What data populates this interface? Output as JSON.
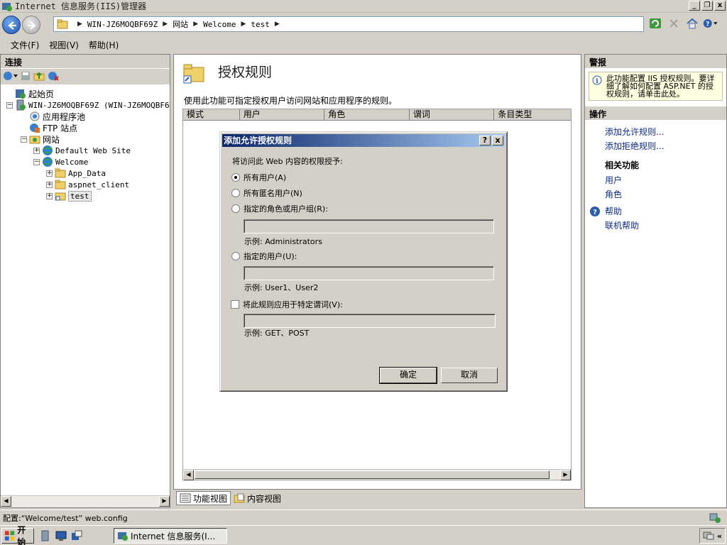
{
  "window": {
    "title": "Internet 信息服务(IIS)管理器",
    "buttons": {
      "minimize": "_",
      "restore": "❐",
      "close": "x"
    }
  },
  "address": {
    "crumbs": [
      "WIN-JZ6MOQBF69Z",
      "网站",
      "Welcome",
      "test"
    ]
  },
  "menu": [
    "文件(F)",
    "视图(V)",
    "帮助(H)"
  ],
  "connections": {
    "title": "连接",
    "tree": {
      "start_page": "起始页",
      "server": "WIN-JZ6MOQBF69Z (WIN-JZ6MOQBF69Z",
      "app_pools": "应用程序池",
      "ftp_sites": "FTP 站点",
      "sites": "网站",
      "default_site": "Default Web Site",
      "welcome": "Welcome",
      "app_data": "App_Data",
      "aspnet_client": "aspnet_client",
      "test": "test"
    }
  },
  "feature": {
    "title": "授权规则",
    "description": "使用此功能可指定授权用户访问网站和应用程序的规则。",
    "columns": [
      "模式",
      "用户",
      "角色",
      "谓词",
      "条目类型"
    ]
  },
  "view_tabs": {
    "features": "功能视图",
    "content": "内容视图"
  },
  "alerts": {
    "title": "警报",
    "message": "此功能配置 IIS 授权规则。要详细了解如何配置 ASP.NET 的授权规则，请单击此处。"
  },
  "actions": {
    "title": "操作",
    "add_allow": "添加允许规则...",
    "add_deny": "添加拒绝规则...",
    "related_title": "相关功能",
    "users": "用户",
    "roles": "角色",
    "help": "帮助",
    "online_help": "联机帮助"
  },
  "dialog": {
    "title": "添加允许授权规则",
    "help_btn": "?",
    "close_btn": "x",
    "prompt": "将访问此 Web 内容的权限授予:",
    "opt_all_users": "所有用户(A)",
    "opt_anonymous": "所有匿名用户(N)",
    "opt_roles": "指定的角色或用户组(R):",
    "roles_example": "示例: Administrators",
    "roles_value": "",
    "opt_users": "指定的用户(U):",
    "users_example": "示例: User1、User2",
    "users_value": "",
    "verbs_check": "将此规则应用于特定谓词(V):",
    "verbs_example": "示例: GET、POST",
    "verbs_value": "",
    "selected_option": "所有用户(A)",
    "ok": "确定",
    "cancel": "取消"
  },
  "status": {
    "text": "配置:“Welcome/test” web.config"
  },
  "taskbar": {
    "start": "开始",
    "task_label": "Internet 信息服务(I..."
  },
  "colors": {
    "dialog_title_start": "#0a246a",
    "dialog_title_end": "#a6caf0",
    "link": "#0c2c84",
    "alert_bg": "#ffffe1"
  }
}
